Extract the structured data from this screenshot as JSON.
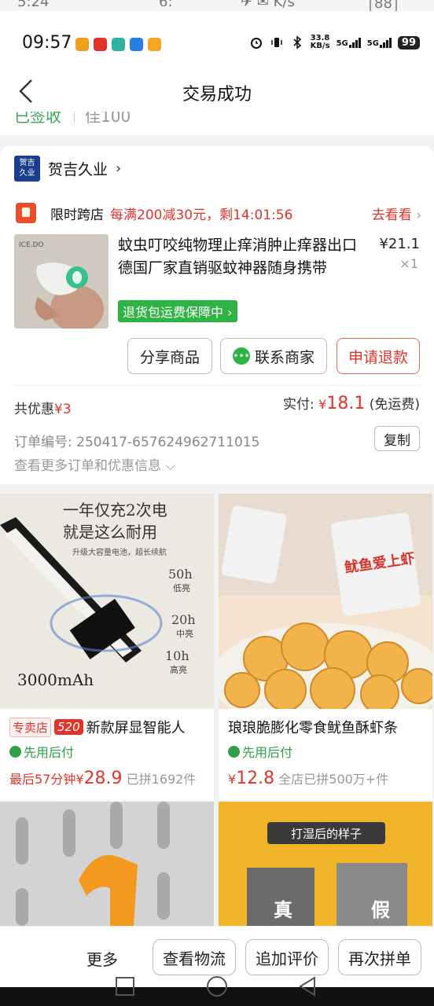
{
  "ghost_status": {
    "time": "5:24",
    "carrier": "6:",
    "icons": "✈ ✉ K/s",
    "battery": "88"
  },
  "status_bar": {
    "time": "09:57",
    "net_speed_value": "33.8",
    "net_speed_unit": "KB/s",
    "signal1": "5G",
    "signal2": "5G",
    "battery": "99"
  },
  "header": {
    "title": "交易成功"
  },
  "peek": {
    "left": "已签收",
    "right": "佳100"
  },
  "store": {
    "logo_line1": "贺吉",
    "logo_line2": "久业",
    "name": "贺吉久业",
    "chevron": "›"
  },
  "promo": {
    "label": "限时跨店",
    "text": "每满200减30元，剩14:01:56",
    "link": "去看看",
    "chevron": "›"
  },
  "product": {
    "title": "蚊虫叮咬纯物理止痒消肿止痒器出口德国厂家直销驱蚊神器随身携带",
    "price": "¥21.1",
    "qty": "×1",
    "guarantee": "退货包运费保障中 ›",
    "img_brand": "ICE.DO"
  },
  "actions": {
    "share": "分享商品",
    "contact": "联系商家",
    "refund": "申请退款"
  },
  "totals": {
    "discount_label": "共优惠",
    "discount_value": "¥3",
    "paid_label": "实付: ",
    "paid_currency": "¥",
    "paid_value": "18.1",
    "shipping": " (免运费)"
  },
  "order": {
    "number": "订单编号: 250417-657624962711015",
    "copy": "复制",
    "more": "查看更多订单和优惠信息 ⌵"
  },
  "recommend": [
    {
      "img_headline1": "一年仅充2次电",
      "img_headline2": "就是这么耐用",
      "img_sub": "升级大容量电池，超长续航",
      "img_modes": [
        {
          "hours": "50h",
          "level": "低亮"
        },
        {
          "hours": "20h",
          "level": "中亮"
        },
        {
          "hours": "10h",
          "level": "高亮"
        }
      ],
      "img_capacity": "3000mAh",
      "tag_store": "专卖店",
      "tag_520": "520",
      "title": "新款屏显智能人",
      "pay": "先用后付",
      "price_prefix": "最后57分钟",
      "price_currency": "¥",
      "price_value": "28.9",
      "sold": "已拼1692件"
    },
    {
      "img_brand": "鱿鱼爱上虾",
      "title": "琅琅脆膨化零食鱿鱼酥虾条",
      "pay": "先用后付",
      "price_currency": "¥",
      "price_value": "12.8",
      "sold": "全店已拼500万+件"
    },
    {
      "img_caption": ""
    },
    {
      "img_caption": "打湿后的样子",
      "label_real": "真",
      "label_fake": "假"
    }
  ],
  "bottom_bar": {
    "more": "更多",
    "logistics": "查看物流",
    "review": "追加评价",
    "reorder": "再次拼单"
  },
  "colors": {
    "accent_red": "#e0342b",
    "accent_green": "#2fb344"
  }
}
